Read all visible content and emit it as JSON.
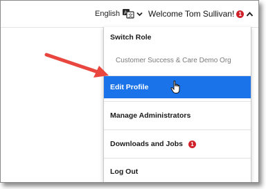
{
  "header": {
    "language_label": "English",
    "welcome_text": "Welcome Tom Sullivan!",
    "notification_count": "1"
  },
  "menu": {
    "switch_role": "Switch Role",
    "org_name": "Customer Success & Care Demo Org",
    "edit_profile": "Edit Profile",
    "manage_admins": "Manage Administrators",
    "downloads_jobs": "Downloads and Jobs",
    "downloads_count": "1",
    "log_out": "Log Out"
  },
  "colors": {
    "highlight": "#1a73e8",
    "badge": "#d0202a",
    "annotation_arrow": "#e8463e"
  },
  "icons": {
    "language": "translate-icon",
    "chevron": "chevron-down-icon",
    "cursor": "hand-pointer-icon",
    "annotation": "red-arrow-annotation"
  }
}
